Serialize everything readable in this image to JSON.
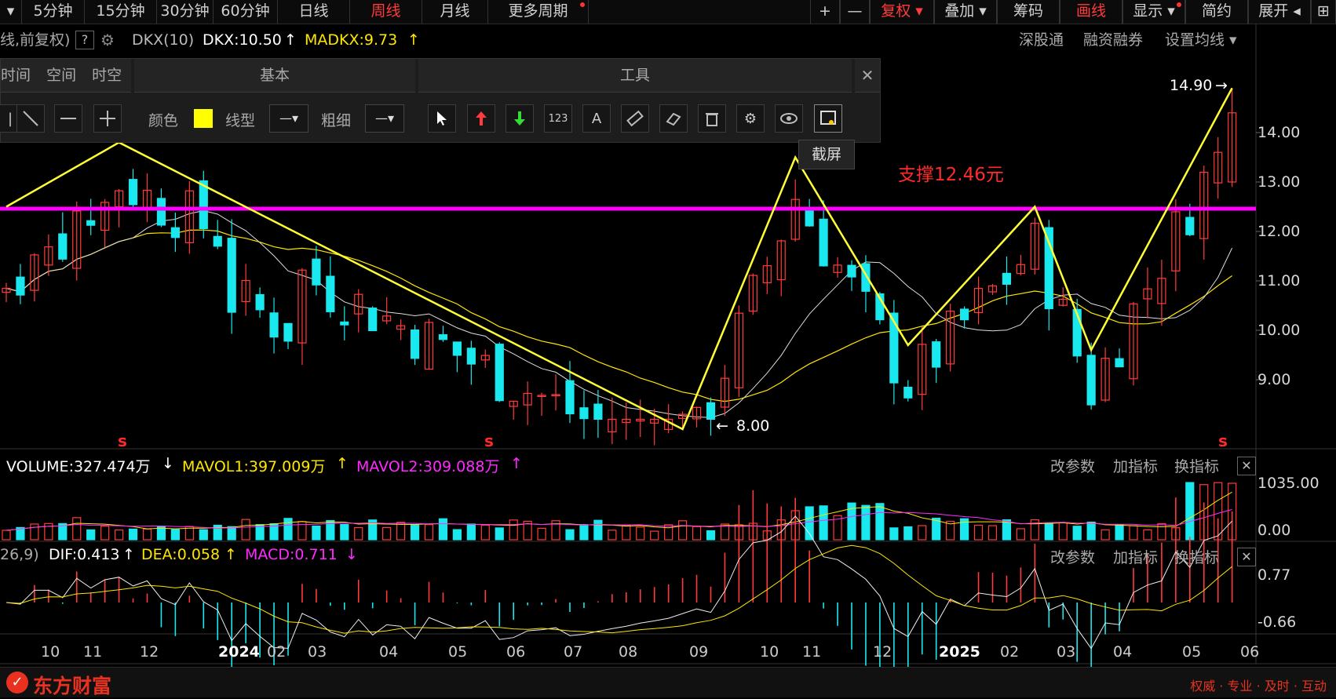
{
  "topbar": {
    "tabs": [
      {
        "label": "▾",
        "w": 28
      },
      {
        "label": "5分钟",
        "w": 80
      },
      {
        "label": "15分钟",
        "w": 92
      },
      {
        "label": "30分钟",
        "w": 72
      },
      {
        "label": "60分钟",
        "w": 82
      },
      {
        "label": "日线",
        "w": 92
      },
      {
        "label": "周线",
        "w": 92,
        "on": true
      },
      {
        "label": "月线",
        "w": 84
      },
      {
        "label": "更多周期",
        "w": 128,
        "dot": true
      }
    ],
    "right_tabs": [
      {
        "label": "+",
        "w": 38
      },
      {
        "label": "—",
        "w": 38
      },
      {
        "label": "复权 ▾",
        "w": 82,
        "on": true
      },
      {
        "label": "叠加 ▾",
        "w": 80
      },
      {
        "label": "筹码",
        "w": 80
      },
      {
        "label": "画线",
        "w": 80,
        "on": true
      },
      {
        "label": "显示 ▾",
        "w": 80,
        "dot": true
      },
      {
        "label": "简约",
        "w": 80
      },
      {
        "label": "展开 ◂",
        "w": 80
      },
      {
        "label": "⊞",
        "w": 32
      }
    ]
  },
  "infobar": {
    "prefix": "线,前复权)",
    "help": "?",
    "indicator": "DKX(10)",
    "dkx": "DKX:10.50",
    "madkx": "MADKX:9.73",
    "links": [
      "深股通",
      "融资融券",
      "设置均线 ▾"
    ]
  },
  "panel": {
    "left_header_items": [
      "时间",
      "空间",
      "时空"
    ],
    "basic_header": "基本",
    "tools_header": "工具",
    "close": "✕",
    "color_label": "颜色",
    "linetype_label": "线型",
    "thickness_label": "粗细",
    "swatch_color": "#ffff00",
    "tooltip": "截屏"
  },
  "main_chart": {
    "support_label": "支撑12.46元",
    "support_value": 12.46,
    "high_label": "14.90",
    "low_label": "8.00",
    "price_axis": [
      "14.00",
      "13.00",
      "12.00",
      "11.00",
      "10.00",
      "9.00"
    ],
    "s_marker": "s"
  },
  "volume": {
    "label": "VOLUME:327.474万",
    "mavol1": "MAVOL1:397.009万",
    "mavol2": "MAVOL2:309.088万",
    "axis_top": "1035.00",
    "axis_bottom": "0.00"
  },
  "macd": {
    "prefix": "26,9)",
    "dif": "DIF:0.413",
    "dea": "DEA:0.058",
    "macd": "MACD:0.711",
    "axis_top": "0.77",
    "axis_bottom": "-0.66"
  },
  "panel_actions": [
    "改参数",
    "加指标",
    "换指标"
  ],
  "time_axis": [
    "10",
    "11",
    "12",
    "2024",
    "02",
    "03",
    "04",
    "05",
    "06",
    "07",
    "08",
    "09",
    "10",
    "11",
    "12",
    "2025",
    "02",
    "03",
    "04",
    "05",
    "06"
  ],
  "brand": {
    "name": "东方财富",
    "slogan": "权威 · 专业 · 及时 · 互动"
  },
  "colors": {
    "up": "#ff3b3b",
    "down": "#19e8ee",
    "support": "#ff00ff",
    "drawline": "#ffff33",
    "ma_slow": "#ffe600",
    "ma_fast": "#dddddd"
  },
  "chart_data": {
    "type": "candlestick",
    "title": "",
    "xlabel": "",
    "ylabel": "",
    "ylim": [
      8.0,
      15.0
    ],
    "weeks": 88,
    "annotated_high": 14.9,
    "annotated_low": 8.0,
    "support_line": 12.46,
    "wave_points": [
      {
        "week": 0,
        "price": 12.5
      },
      {
        "week": 8,
        "price": 13.8
      },
      {
        "week": 48,
        "price": 8.0
      },
      {
        "week": 56,
        "price": 13.5
      },
      {
        "week": 64,
        "price": 9.7
      },
      {
        "week": 73,
        "price": 12.5
      },
      {
        "week": 77,
        "price": 9.6
      },
      {
        "week": 87,
        "price": 14.9
      }
    ]
  }
}
